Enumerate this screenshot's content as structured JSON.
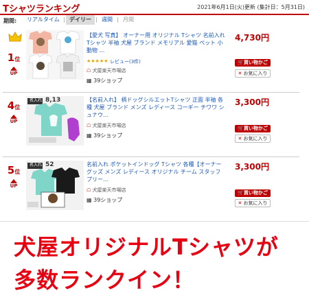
{
  "header": {
    "title": "Tシャツランキング",
    "updated": "2021年6月1日(火)更新 (集計日：5月31日)"
  },
  "period": {
    "label": "期間:",
    "tabs": [
      {
        "label": "リアルタイム",
        "active": false
      },
      {
        "label": "デイリー",
        "active": true
      },
      {
        "label": "週間",
        "active": false
      },
      {
        "label": "月間",
        "active": false
      }
    ],
    "separator": "|"
  },
  "items": [
    {
      "rank": "1",
      "rank_unit": "位",
      "trend": "UP",
      "title": "【愛犬 写真】 オーナー用 オリジナル Tシャツ 名前入れ Tシャツ 半袖 犬屋 ブランド メモリアル 愛猫 ペット 小動物 …",
      "stars": "★★★★★",
      "reviews": "レビュー(3件)",
      "shop_area": "犬屋楽天市場店",
      "shop_count": "39ショップ",
      "price": "4,730円",
      "buy_label": "買い物かご",
      "fav_label": "お気に入り"
    },
    {
      "rank": "4",
      "rank_unit": "位",
      "trend": "UP",
      "title": "【名前入れ】 柄ドッグシルエットTシャツ 正面 半袖 各種 犬屋 ブランド メンズ レディース コーギー チワワ シュナウ…",
      "shop_area": "犬屋楽天市場店",
      "shop_count": "39ショップ",
      "price": "3,300円",
      "buy_label": "買い物かご",
      "fav_label": "お気に入り",
      "badge": "名入れ",
      "size_text": "8,13"
    },
    {
      "rank": "5",
      "rank_unit": "位",
      "trend": "UP",
      "title": "名前入れ ポケットインドッグ Tシャツ 各種【オーナー グッズ メンズ レディース オリジナル チーム スタッフ プリー…",
      "shop_area": "犬屋楽天市場店",
      "shop_count": "39ショップ",
      "price": "3,300円",
      "buy_label": "買い物かご",
      "fav_label": "お気に入り",
      "badge": "名入れ",
      "size_text": "52"
    }
  ],
  "banner": {
    "line1": "犬屋オリジナルTシャツが",
    "line2": "多数ランクイン！"
  },
  "colors": {
    "accent": "#bf0000",
    "link": "#1b57b9",
    "banner_text": "#e60012",
    "shirt_white": "#ffffff",
    "shirt_salmon": "#f4b6a4",
    "shirt_mint": "#7fd6c8",
    "shirt_black": "#1a1a1a"
  }
}
